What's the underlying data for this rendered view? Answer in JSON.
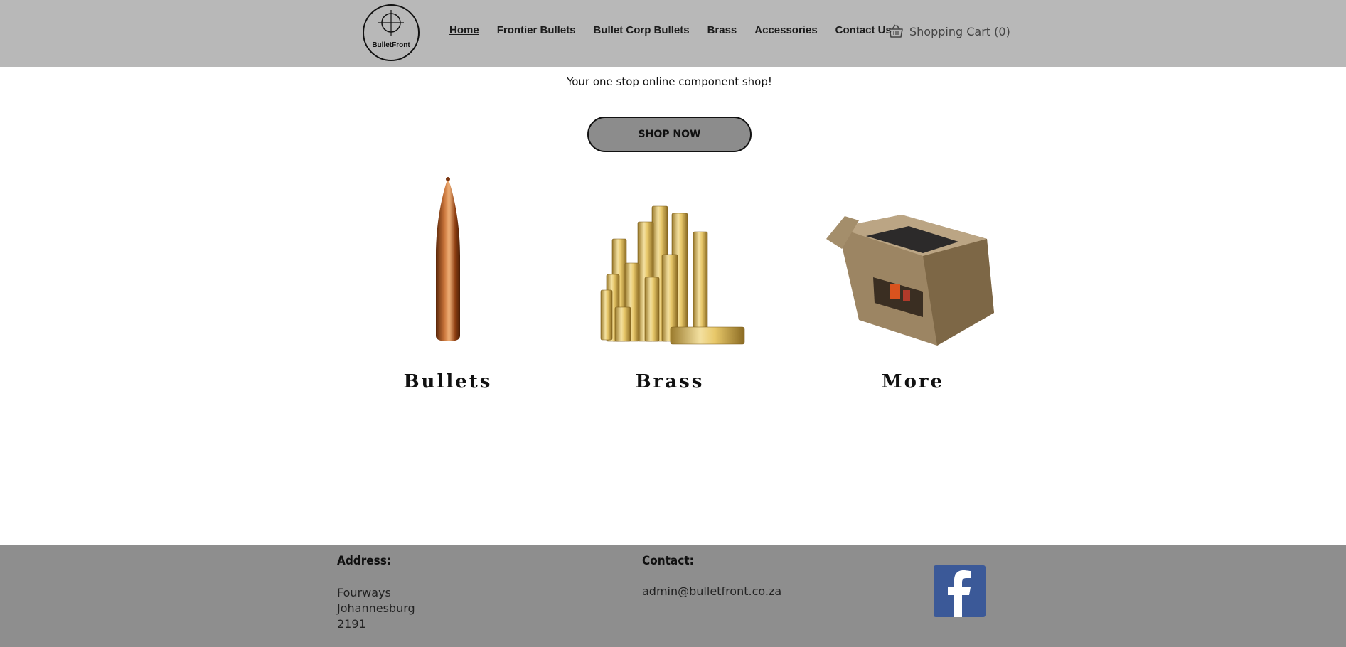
{
  "header": {
    "logo_text": "BulletFront",
    "nav": [
      {
        "label": "Home",
        "active": true
      },
      {
        "label": "Frontier Bullets",
        "active": false
      },
      {
        "label": "Bullet Corp Bullets",
        "active": false
      },
      {
        "label": "Brass",
        "active": false
      },
      {
        "label": "Accessories",
        "active": false
      },
      {
        "label": "Contact Us",
        "active": false
      }
    ],
    "cart": {
      "label": "Shopping Cart (0)",
      "icon": "basket-icon"
    }
  },
  "hero": {
    "tagline": "Your one stop online component shop!",
    "button_label": "SHOP NOW"
  },
  "categories": [
    {
      "title": "Bullets",
      "image": "bullet-image"
    },
    {
      "title": "Brass",
      "image": "brass-cases-image"
    },
    {
      "title": "More",
      "image": "range-bag-image"
    }
  ],
  "footer": {
    "address_heading": "Address:",
    "address_lines": [
      "Fourways",
      "Johannesburg",
      "2191"
    ],
    "contact_heading": "Contact:",
    "email": "admin@bulletfront.co.za",
    "social_icon": "facebook-icon"
  },
  "colors": {
    "header_bg": "#b8b8b8",
    "footer_bg": "#8e8e8e",
    "button_bg": "#8c8c8c",
    "facebook_blue": "#3b5998"
  }
}
